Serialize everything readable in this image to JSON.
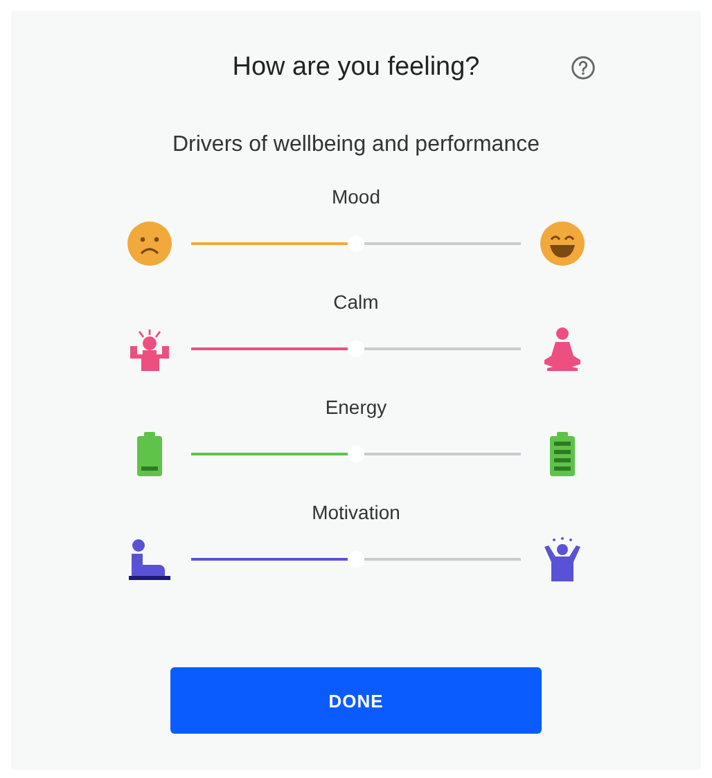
{
  "title": "How are you feeling?",
  "subtitle": "Drivers of wellbeing and performance",
  "sliders": [
    {
      "label": "Mood",
      "kind": "mood",
      "color": "#f2a93b",
      "level": 0.5
    },
    {
      "label": "Calm",
      "kind": "calm",
      "color": "#ec4f80",
      "level": 0.5
    },
    {
      "label": "Energy",
      "kind": "energy",
      "color": "#5fc34a",
      "level": 0.5
    },
    {
      "label": "Motivation",
      "kind": "motivation",
      "color": "#5a52d6",
      "level": 0.5
    }
  ],
  "button": "DONE"
}
